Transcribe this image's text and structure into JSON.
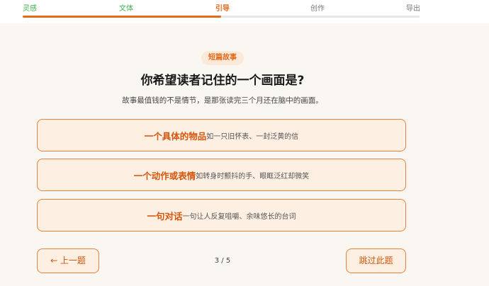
{
  "steps": [
    "灵感",
    "文体",
    "引导",
    "创作",
    "导出"
  ],
  "progress": {
    "current_step": 3,
    "total_steps": 5,
    "fill_fraction": 0.5
  },
  "colors": {
    "accent": "#e26a1f",
    "done": "#3dae4f",
    "option_bg": "#fdefe2",
    "page_bg": "#faf7f2"
  },
  "badge": "短篇故事",
  "question": "你希望读者记住的一个画面是?",
  "subtitle": "故事最值钱的不是情节，是那张读完三个月还在脑中的画面。",
  "options": [
    {
      "title": "一个具体的物品",
      "desc": "如一只旧怀表、一封泛黄的信"
    },
    {
      "title": "一个动作或表情",
      "desc": "如转身时颤抖的手、眼眶泛红却微笑"
    },
    {
      "title": "一句对话",
      "desc": "一句让人反复咀嚼、余味悠长的台词"
    }
  ],
  "nav": {
    "prev_label": "← 上一题",
    "page_indicator": "3 / 5",
    "skip_label": "跳过此题"
  }
}
